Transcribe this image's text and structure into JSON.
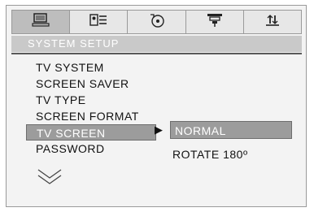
{
  "tabs": [
    {
      "icon": "monitor-icon"
    },
    {
      "icon": "language-icon"
    },
    {
      "icon": "audio-disc-icon"
    },
    {
      "icon": "video-icon"
    },
    {
      "icon": "preferences-icon"
    }
  ],
  "header": {
    "title": "SYSTEM SETUP"
  },
  "menu": {
    "items": [
      {
        "label": "TV SYSTEM"
      },
      {
        "label": "SCREEN SAVER"
      },
      {
        "label": "TV TYPE"
      },
      {
        "label": "SCREEN FORMAT"
      },
      {
        "label": "TV SCREEN"
      },
      {
        "label": "PASSWORD"
      }
    ],
    "selected_index": 4,
    "more_icon": "chevron-down-double-icon"
  },
  "submenu": {
    "arrow": "▶",
    "options": [
      {
        "label": "NORMAL"
      },
      {
        "label": "ROTATE 180º"
      }
    ]
  }
}
